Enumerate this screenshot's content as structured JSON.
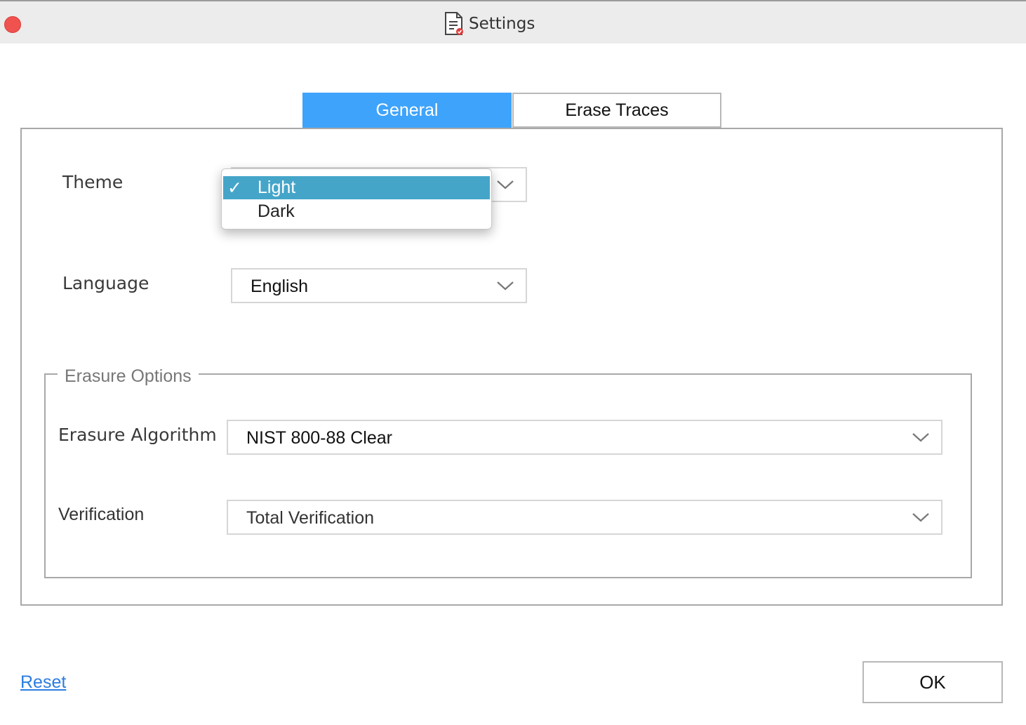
{
  "window": {
    "title": "Settings"
  },
  "tabs": [
    {
      "label": "General",
      "active": true
    },
    {
      "label": "Erase Traces",
      "active": false
    }
  ],
  "general": {
    "theme": {
      "label": "Theme",
      "options": [
        {
          "label": "Light",
          "checked": true,
          "highlighted": true
        },
        {
          "label": "Dark",
          "checked": false,
          "highlighted": false
        }
      ],
      "check_mark": "✓"
    },
    "language": {
      "label": "Language",
      "value": "English"
    },
    "erasure_options": {
      "legend": "Erasure Options",
      "algorithm": {
        "label": "Erasure Algorithm",
        "value": "NIST 800-88 Clear"
      },
      "verification": {
        "label": "Verification",
        "value": "Total Verification"
      }
    }
  },
  "footer": {
    "reset_label": "Reset",
    "ok_label": "OK"
  },
  "colors": {
    "tab_active": "#3ea3fb",
    "option_highlight": "#45a5c9",
    "close_button": "#f0524f",
    "link": "#2b7de0"
  },
  "icons": [
    "close-icon",
    "settings-document-icon",
    "chevron-down-icon",
    "checkmark-icon"
  ]
}
